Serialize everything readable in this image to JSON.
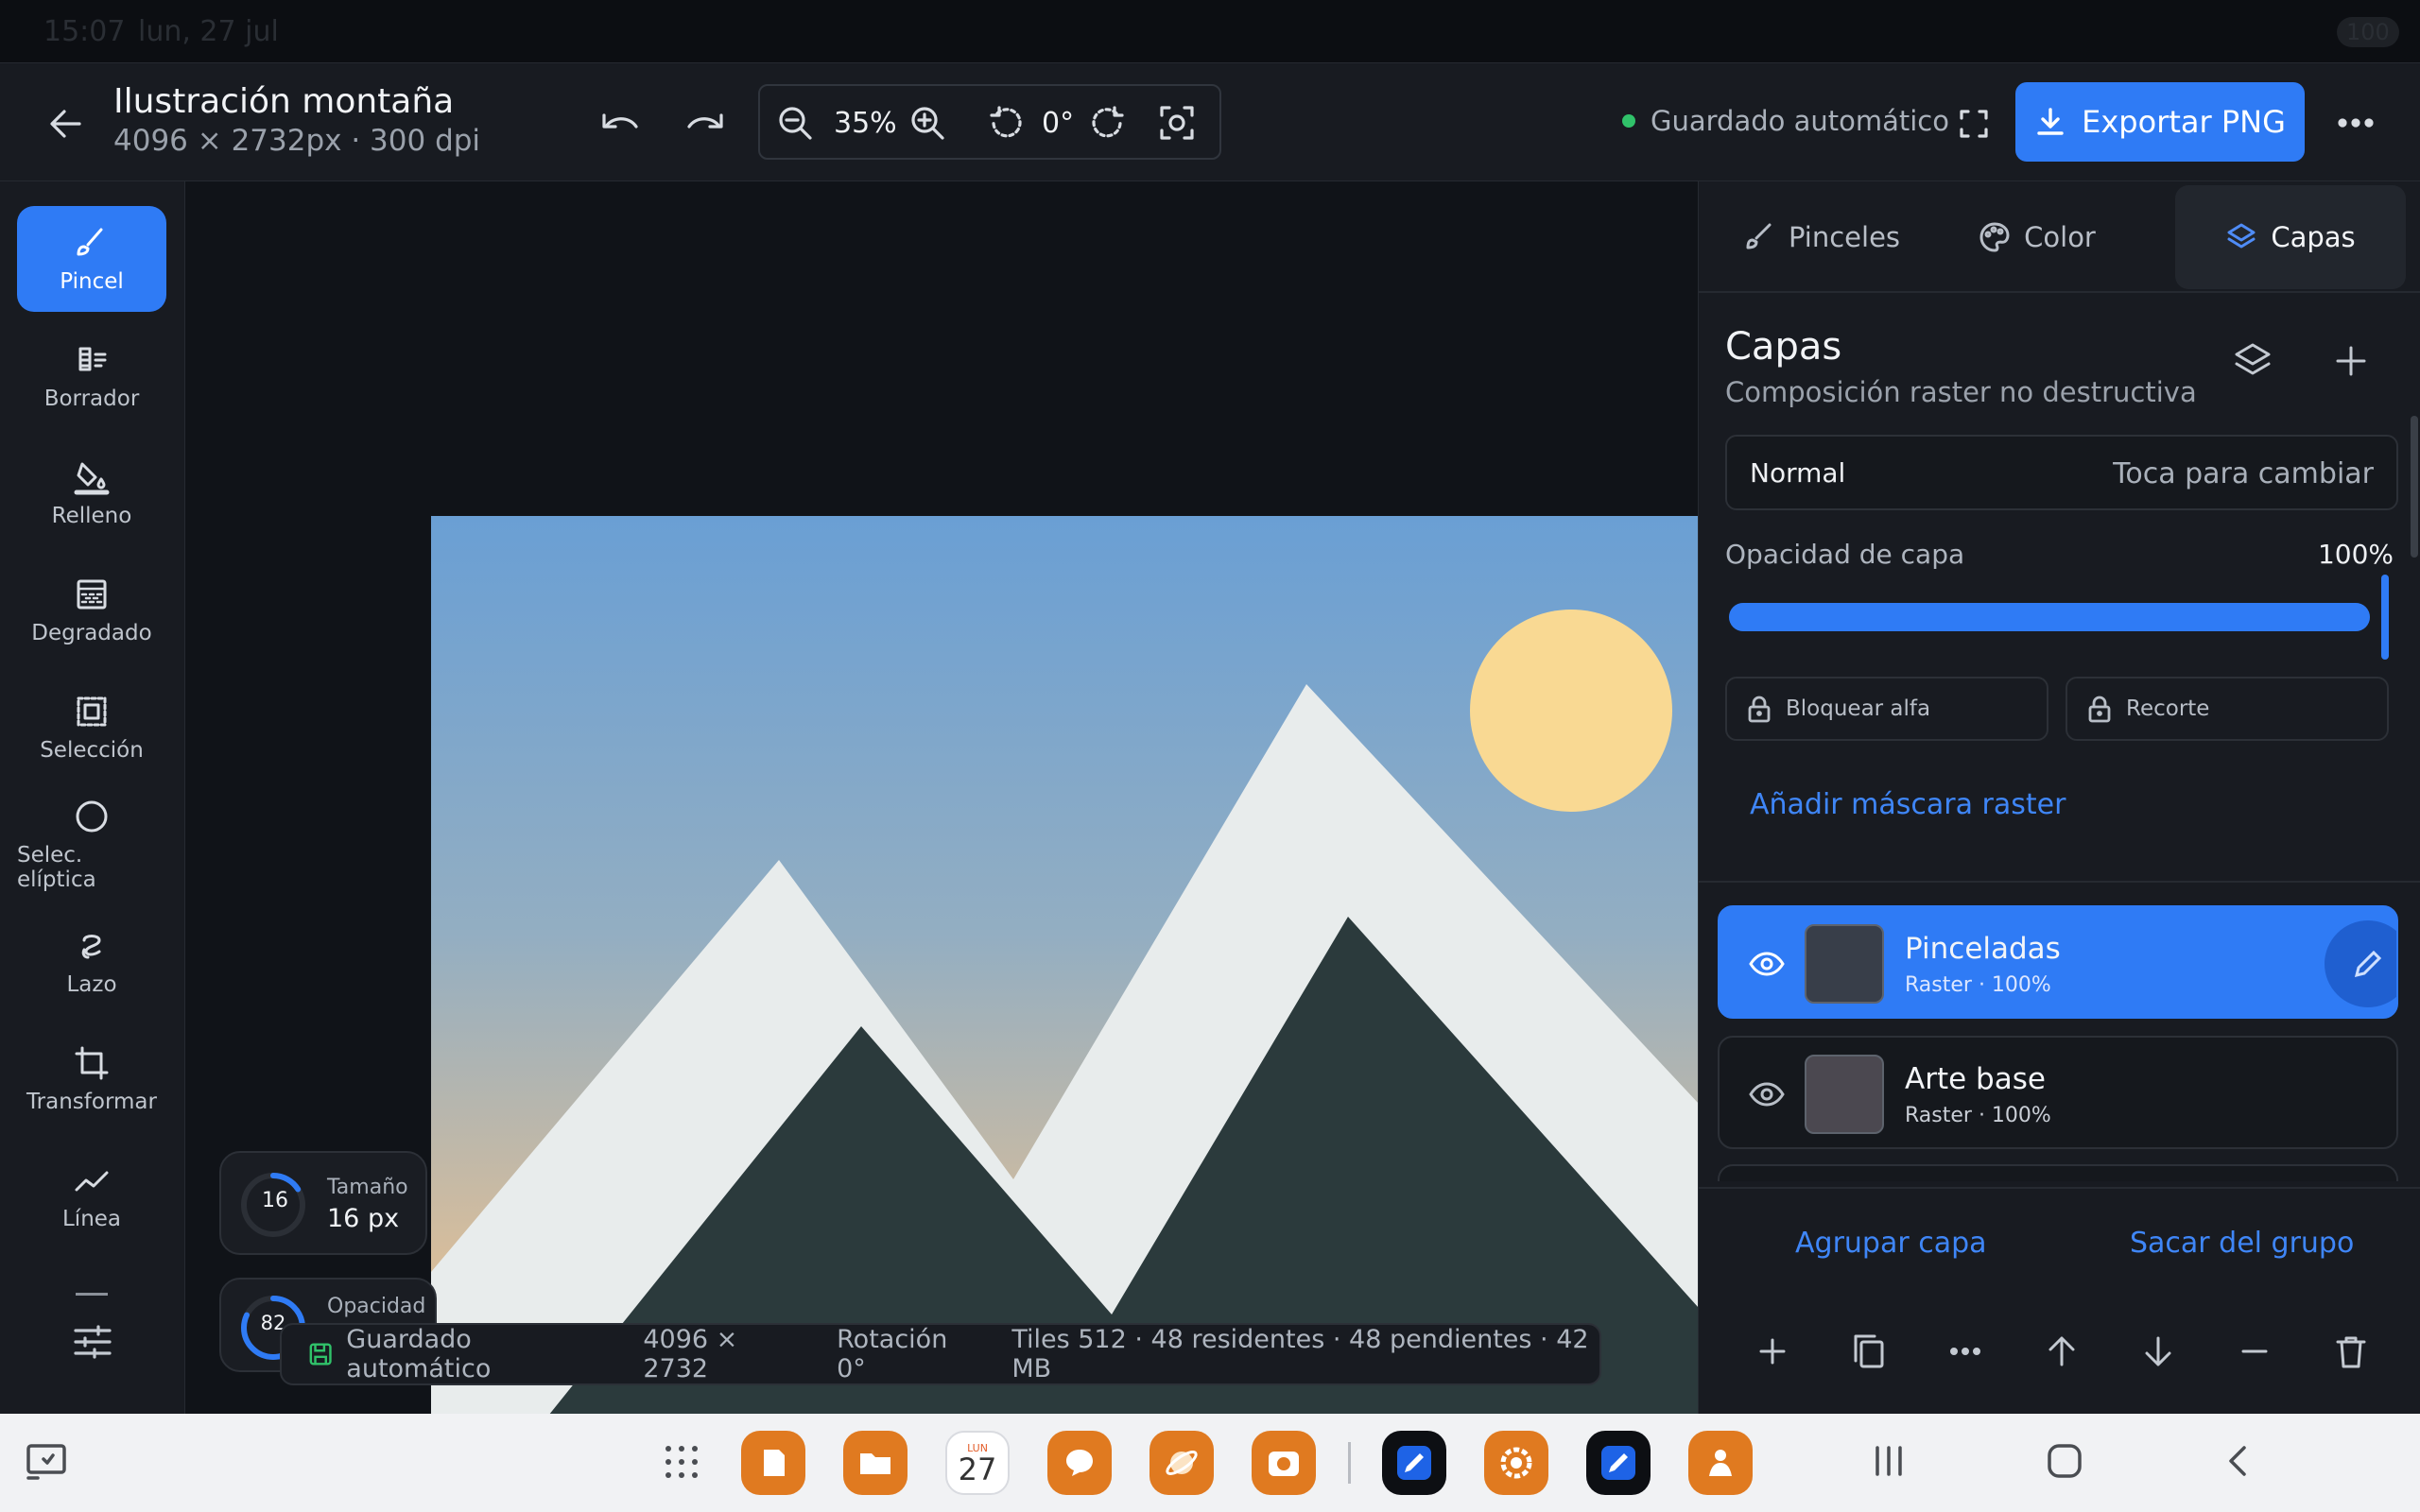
{
  "status_bar": {
    "time": "15:07",
    "date": "lun, 27 jul",
    "battery": "100"
  },
  "header": {
    "title": "Ilustración montaña",
    "subtitle": "4096 × 2732px · 300 dpi",
    "zoom": "35%",
    "rotation": "0°",
    "autosave": "Guardado automático",
    "export_label": "Exportar PNG"
  },
  "tools": [
    {
      "id": "pincel",
      "label": "Pincel",
      "icon": "brush-icon",
      "active": true
    },
    {
      "id": "borrador",
      "label": "Borrador",
      "icon": "eraser-icon"
    },
    {
      "id": "relleno",
      "label": "Relleno",
      "icon": "bucket-icon"
    },
    {
      "id": "degradado",
      "label": "Degradado",
      "icon": "gradient-icon"
    },
    {
      "id": "seleccion",
      "label": "Selección",
      "icon": "selection-icon"
    },
    {
      "id": "selec-eliptica",
      "label": "Selec. elíptica",
      "icon": "ellipse-icon"
    },
    {
      "id": "lazo",
      "label": "Lazo",
      "icon": "lasso-icon"
    },
    {
      "id": "transformar",
      "label": "Transformar",
      "icon": "crop-icon"
    },
    {
      "id": "linea",
      "label": "Línea",
      "icon": "line-icon"
    }
  ],
  "hud": {
    "size_label": "Tamaño",
    "size_value": "16 px",
    "size_ring": "16",
    "size_fraction": 0.16,
    "opacity_label": "Opacidad",
    "opacity_ring": "82",
    "opacity_fraction": 0.82
  },
  "infobar": {
    "autosave": "Guardado automático",
    "dimensions": "4096 × 2732",
    "rotation": "Rotación 0°",
    "tiles": "Tiles 512 · 48 residentes · 48 pendientes · 42 MB"
  },
  "panel": {
    "tabs": [
      {
        "label": "Pinceles",
        "icon": "brush-icon"
      },
      {
        "label": "Color",
        "icon": "palette-icon"
      },
      {
        "label": "Capas",
        "icon": "layers-icon",
        "active": true
      }
    ],
    "title": "Capas",
    "subtitle": "Composición raster no destructiva",
    "blend_mode": "Normal",
    "blend_hint": "Toca para cambiar",
    "opacity_label": "Opacidad de capa",
    "opacity_value": "100%",
    "opacity_fraction": 1.0,
    "lock_alpha": "Bloquear alfa",
    "clip": "Recorte",
    "add_mask": "Añadir máscara raster",
    "layers": [
      {
        "name": "Pinceladas",
        "meta": "Raster · 100%",
        "thumb": "#383e49",
        "active": true
      },
      {
        "name": "Arte base",
        "meta": "Raster · 100%",
        "thumb": "#4b4850"
      }
    ],
    "group_layer": "Agrupar capa",
    "ungroup": "Sacar del grupo"
  },
  "dock": {
    "apps": [
      {
        "name": "notes",
        "color": "#e07a20"
      },
      {
        "name": "files",
        "color": "#e07a20"
      },
      {
        "name": "calendar",
        "color": "#ffffff"
      },
      {
        "name": "messages",
        "color": "#e07a20"
      },
      {
        "name": "browser",
        "color": "#e07a20"
      },
      {
        "name": "camera",
        "color": "#e07a20"
      },
      {
        "name": "paint",
        "color": "#0d0f13"
      },
      {
        "name": "settings",
        "color": "#e07a20"
      },
      {
        "name": "paint-2",
        "color": "#0d0f13"
      },
      {
        "name": "assistant",
        "color": "#e07a20"
      }
    ],
    "calendar_day": "LUN",
    "calendar_date": "27"
  },
  "colors": {
    "accent": "#2f7bf5",
    "sky_top": "#6a9fd4",
    "sky_bottom": "#d6bd9c",
    "sun": "#f9d993",
    "snow": "#e8ecec",
    "mountain": "#2b3a3c"
  }
}
